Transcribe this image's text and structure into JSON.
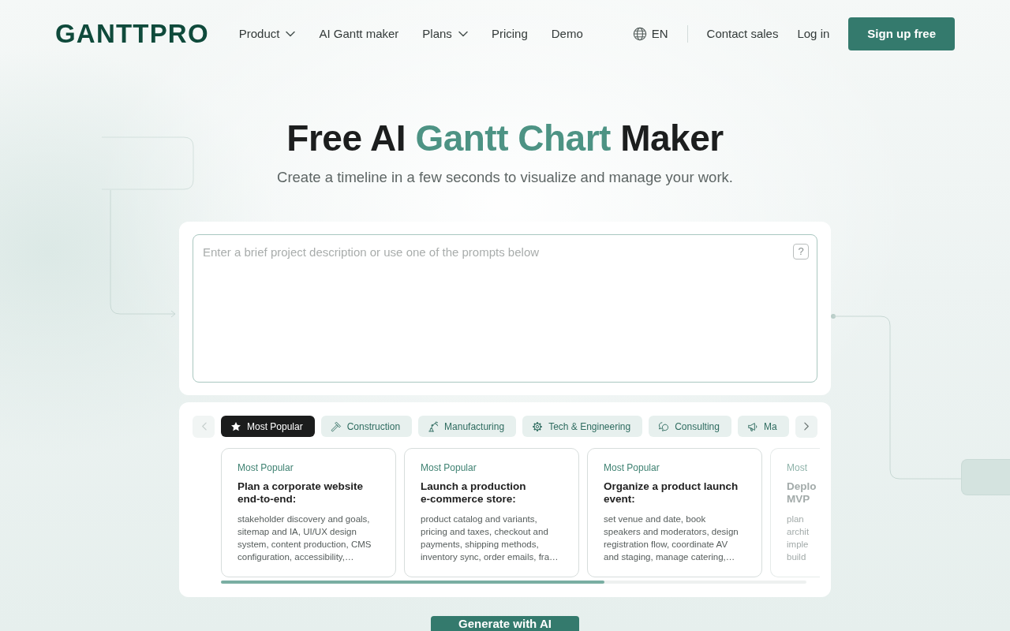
{
  "header": {
    "logo": "GANTTPRO",
    "nav": [
      {
        "label": "Product",
        "dropdown": true
      },
      {
        "label": "AI Gantt maker",
        "dropdown": false
      },
      {
        "label": "Plans",
        "dropdown": true
      },
      {
        "label": "Pricing",
        "dropdown": false
      },
      {
        "label": "Demo",
        "dropdown": false
      }
    ],
    "language": "EN",
    "contact": "Contact sales",
    "login": "Log in",
    "signup": "Sign up free"
  },
  "hero": {
    "title": [
      {
        "text": "Free AI",
        "highlight": false
      },
      {
        "text": "Gantt Chart",
        "highlight": true
      },
      {
        "text": "Maker",
        "highlight": false
      }
    ],
    "subtitle": "Create a timeline in a few seconds to visualize and manage your work."
  },
  "prompt": {
    "placeholder": "Enter a brief project description or use one of the prompts below",
    "help": "?"
  },
  "categories": {
    "prev": {
      "disabled": true
    },
    "next": {
      "disabled": false
    },
    "tabs": [
      {
        "label": "Most Popular",
        "selected": true
      },
      {
        "label": "Construction",
        "selected": false
      },
      {
        "label": "Manufacturing",
        "selected": false
      },
      {
        "label": "Tech & Engineering",
        "selected": false
      },
      {
        "label": "Consulting",
        "selected": false
      },
      {
        "label": "Ma",
        "selected": false
      }
    ]
  },
  "cards": [
    {
      "tag": "Most Popular",
      "title": "Plan a corporate website end-to-end:",
      "text": "stakeholder discovery and goals, sitemap and IA, UI/UX design system, content production, CMS configuration, accessibility,…",
      "faded": false
    },
    {
      "tag": "Most Popular",
      "title": "Launch a production e-commerce store:",
      "text": "product catalog and variants, pricing and taxes, checkout and payments, shipping methods, inventory sync, order emails, fra…",
      "faded": false
    },
    {
      "tag": "Most Popular",
      "title": "Organize a product launch event:",
      "text": "set venue and date, book speakers and moderators, design registration flow, coordinate AV and staging, manage catering,…",
      "faded": false
    },
    {
      "tag": "Most",
      "title": "Deplo MVP",
      "text": "plan archit imple build",
      "faded": true
    }
  ],
  "generate": {
    "label": "Generate with AI"
  }
}
